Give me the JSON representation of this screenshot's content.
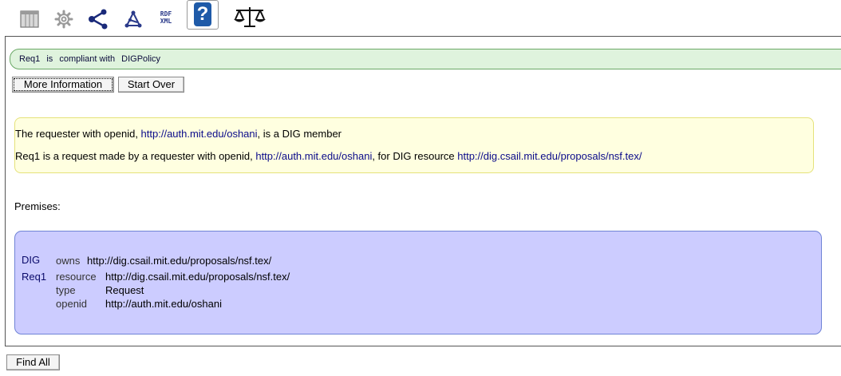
{
  "toolbar": {
    "icons": [
      "table-view-icon",
      "settings-gear-icon",
      "graph-share-icon",
      "graph-alt-icon",
      "rdf-xml-icon",
      "help-question-icon",
      "justice-scales-icon"
    ],
    "rdf_top": "RDF",
    "rdf_bottom": "XML",
    "help_glyph": "?"
  },
  "status": {
    "subject": "Req1",
    "verb": "is",
    "state": "compliant with",
    "policy": "DIGPolicy",
    "color": "#dff3dd"
  },
  "buttons": {
    "more_info": "More Information",
    "start_over": "Start Over",
    "find_all": "Find All"
  },
  "justification": {
    "line1": {
      "prefix": "The requester with openid, ",
      "openid": "http://auth.mit.edu/oshani",
      "suffix": ", is a DIG member"
    },
    "line2": {
      "prefix": "Req1 is a request made by a requester with openid, ",
      "openid": "http://auth.mit.edu/oshani",
      "middle": ", for DIG resource ",
      "resource": "http://dig.csail.mit.edu/proposals/nsf.tex/"
    }
  },
  "premises": {
    "label": "Premises:",
    "triples": [
      {
        "subject": "DIG",
        "predicate": "owns",
        "object": "http://dig.csail.mit.edu/proposals/nsf.tex/"
      },
      {
        "subject": "Req1",
        "predicate": "resource",
        "object": "http://dig.csail.mit.edu/proposals/nsf.tex/"
      },
      {
        "subject": "",
        "predicate": "type",
        "object": "Request"
      },
      {
        "subject": "",
        "predicate": "openid",
        "object": "http://auth.mit.edu/oshani"
      }
    ]
  }
}
